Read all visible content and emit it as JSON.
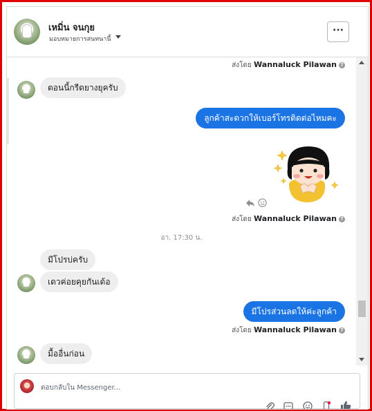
{
  "header": {
    "name": "เหมิ่น จนกุย",
    "subtitle": "มอบหมายการสนทนานี้"
  },
  "messages": [
    {
      "kind": "sentby",
      "prefix": "ส่งโดย",
      "agent": "Wannaluck Pilawan"
    },
    {
      "kind": "in",
      "text": "ตอนนี้กรีดยางยุครับ"
    },
    {
      "kind": "out",
      "text": "ลูกค้าสะดวกให้เบอร์โทรติดต่อไหมคะ"
    },
    {
      "kind": "sentby",
      "prefix": "ส่งโดย",
      "agent": "Wannaluck Pilawan"
    },
    {
      "kind": "timestamp",
      "text": "อา. 17:30 น."
    },
    {
      "kind": "in",
      "text": "มีโปรบ่ครับ"
    },
    {
      "kind": "in",
      "text": "เดวค่อยคุยกันเด้อ"
    },
    {
      "kind": "out",
      "text": "มีโปรส่วนลดให้ค่ะลูกค้า"
    },
    {
      "kind": "sentby",
      "prefix": "ส่งโดย",
      "agent": "Wannaluck Pilawan"
    },
    {
      "kind": "in",
      "text": "มื้ออื่นก่อน"
    }
  ],
  "composer": {
    "placeholder": "ตอบกลับใน Messenger..."
  },
  "colors": {
    "accent": "#1b74e4",
    "frame": "#e00000",
    "incoming_bubble": "#eeeeee"
  },
  "icons": [
    "more-icon",
    "reply-icon",
    "react-icon",
    "attach-icon",
    "gif-icon",
    "emoji-icon",
    "sticker-icon",
    "like-icon"
  ]
}
